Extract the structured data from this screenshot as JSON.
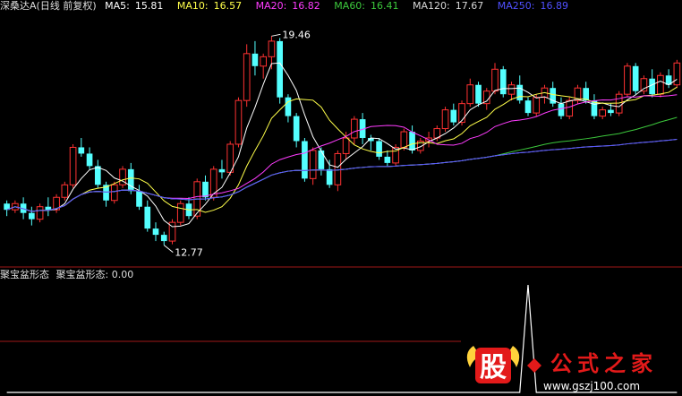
{
  "header": {
    "stock": "深桑达A",
    "mode": "(日线 前复权)",
    "indicators": [
      {
        "label": "MA5:",
        "value": "15.81",
        "color": "#ffffff"
      },
      {
        "label": "MA10:",
        "value": "16.57",
        "color": "#ffff4a"
      },
      {
        "label": "MA20:",
        "value": "16.82",
        "color": "#ff3cff"
      },
      {
        "label": "MA60:",
        "value": "16.41",
        "color": "#3cc83c"
      },
      {
        "label": "MA120:",
        "value": "17.67",
        "color": "#d7d7d7"
      },
      {
        "label": "MA250:",
        "value": "16.89",
        "color": "#5050ff"
      }
    ]
  },
  "sub_panel": {
    "title": "聚宝盆形态",
    "indicator": "聚宝盆形态:",
    "value": "0.00"
  },
  "watermark": {
    "char": "股",
    "brand": "公式之家",
    "url": "www.gszj100.com"
  },
  "colors": {
    "up": "#ff3232",
    "down": "#54ffff",
    "ma5": "#ffffff",
    "ma10": "#ffff4a",
    "ma20": "#ff3cff",
    "ma60": "#3cc83c",
    "ma120": "#d7d7d7",
    "ma250": "#5050ff",
    "separator": "#a01818"
  },
  "chart_data": [
    {
      "type": "candlestick",
      "annotations": [
        {
          "label": "19.46",
          "value": 19.46
        },
        {
          "label": "12.77",
          "value": 12.77
        }
      ],
      "ylim": [
        12.3,
        20.1
      ],
      "candles": [
        [
          14.1,
          14.2,
          13.7,
          13.9
        ],
        [
          13.9,
          14.2,
          13.8,
          14.1
        ],
        [
          14.1,
          14.3,
          13.6,
          13.8
        ],
        [
          13.8,
          14.0,
          13.4,
          13.6
        ],
        [
          13.6,
          14.1,
          13.5,
          14.0
        ],
        [
          14.0,
          14.3,
          13.7,
          13.9
        ],
        [
          13.9,
          14.4,
          13.8,
          14.3
        ],
        [
          14.3,
          14.8,
          14.2,
          14.7
        ],
        [
          14.7,
          16.0,
          14.6,
          15.9
        ],
        [
          15.9,
          16.2,
          15.6,
          15.7
        ],
        [
          15.7,
          15.9,
          15.2,
          15.3
        ],
        [
          15.3,
          15.5,
          14.6,
          14.7
        ],
        [
          14.7,
          14.8,
          14.0,
          14.2
        ],
        [
          14.2,
          14.8,
          14.1,
          14.7
        ],
        [
          14.7,
          15.3,
          14.6,
          15.2
        ],
        [
          15.2,
          15.4,
          14.4,
          14.5
        ],
        [
          14.5,
          14.7,
          13.9,
          14.0
        ],
        [
          14.0,
          14.2,
          13.2,
          13.3
        ],
        [
          13.3,
          13.5,
          12.9,
          13.1
        ],
        [
          13.1,
          13.2,
          12.77,
          12.9
        ],
        [
          12.9,
          13.6,
          12.8,
          13.5
        ],
        [
          13.5,
          14.2,
          13.4,
          14.1
        ],
        [
          14.1,
          14.3,
          13.6,
          13.7
        ],
        [
          13.7,
          14.9,
          13.6,
          14.8
        ],
        [
          14.8,
          15.0,
          14.2,
          14.3
        ],
        [
          14.3,
          15.3,
          14.2,
          15.2
        ],
        [
          15.2,
          15.5,
          14.9,
          15.1
        ],
        [
          15.1,
          16.1,
          15.0,
          16.0
        ],
        [
          16.0,
          17.5,
          15.9,
          17.4
        ],
        [
          17.4,
          19.2,
          17.2,
          18.9
        ],
        [
          18.9,
          19.3,
          18.2,
          18.5
        ],
        [
          18.5,
          18.9,
          18.1,
          18.8
        ],
        [
          18.8,
          19.46,
          18.4,
          19.3
        ],
        [
          19.3,
          19.4,
          17.3,
          17.5
        ],
        [
          17.5,
          17.6,
          16.7,
          16.9
        ],
        [
          16.9,
          17.0,
          15.9,
          16.1
        ],
        [
          16.1,
          16.2,
          14.8,
          14.9
        ],
        [
          14.9,
          15.9,
          14.7,
          15.8
        ],
        [
          15.8,
          15.9,
          15.0,
          15.2
        ],
        [
          15.2,
          15.5,
          14.6,
          14.7
        ],
        [
          14.7,
          15.8,
          14.5,
          15.7
        ],
        [
          15.7,
          16.4,
          15.5,
          16.2
        ],
        [
          16.2,
          16.9,
          16.0,
          16.8
        ],
        [
          16.8,
          17.0,
          16.0,
          16.2
        ],
        [
          16.2,
          16.3,
          15.8,
          16.1
        ],
        [
          16.1,
          16.2,
          15.5,
          15.6
        ],
        [
          15.6,
          15.8,
          15.3,
          15.4
        ],
        [
          15.4,
          16.0,
          15.3,
          15.9
        ],
        [
          15.9,
          16.5,
          15.8,
          16.4
        ],
        [
          16.4,
          16.6,
          15.7,
          15.8
        ],
        [
          15.8,
          16.2,
          15.7,
          16.1
        ],
        [
          16.1,
          16.4,
          15.9,
          16.2
        ],
        [
          16.2,
          16.6,
          16.1,
          16.5
        ],
        [
          16.5,
          17.2,
          16.4,
          17.1
        ],
        [
          17.1,
          17.3,
          16.6,
          16.7
        ],
        [
          16.7,
          17.4,
          16.6,
          17.3
        ],
        [
          17.3,
          18.1,
          17.2,
          17.9
        ],
        [
          17.9,
          18.0,
          17.2,
          17.3
        ],
        [
          17.3,
          17.8,
          17.1,
          17.7
        ],
        [
          17.7,
          18.6,
          17.6,
          18.4
        ],
        [
          18.4,
          18.5,
          17.5,
          17.6
        ],
        [
          17.6,
          18.0,
          17.4,
          17.9
        ],
        [
          17.9,
          18.2,
          17.3,
          17.4
        ],
        [
          17.4,
          17.5,
          16.9,
          17.0
        ],
        [
          17.0,
          17.6,
          16.9,
          17.5
        ],
        [
          17.5,
          17.9,
          17.3,
          17.8
        ],
        [
          17.8,
          18.0,
          17.2,
          17.3
        ],
        [
          17.3,
          17.5,
          16.8,
          16.9
        ],
        [
          16.9,
          17.5,
          16.8,
          17.4
        ],
        [
          17.4,
          17.9,
          17.3,
          17.8
        ],
        [
          17.8,
          18.0,
          17.3,
          17.4
        ],
        [
          17.4,
          17.6,
          16.8,
          16.9
        ],
        [
          16.9,
          17.2,
          16.8,
          17.1
        ],
        [
          17.1,
          17.3,
          16.9,
          17.0
        ],
        [
          17.0,
          17.7,
          16.9,
          17.6
        ],
        [
          17.6,
          18.6,
          17.5,
          18.5
        ],
        [
          18.5,
          18.6,
          17.6,
          17.7
        ],
        [
          17.7,
          18.2,
          17.6,
          18.1
        ],
        [
          18.1,
          18.4,
          17.5,
          17.6
        ],
        [
          17.6,
          18.3,
          17.5,
          18.2
        ],
        [
          18.2,
          18.4,
          17.8,
          17.9
        ],
        [
          17.9,
          18.7,
          17.8,
          18.6
        ]
      ]
    },
    {
      "type": "line",
      "title": "聚宝盆形态",
      "ylim": [
        0,
        1
      ],
      "values": [
        0,
        0,
        0,
        0,
        0,
        0,
        0,
        0,
        0,
        0,
        0,
        0,
        0,
        0,
        0,
        0,
        0,
        0,
        0,
        0,
        0,
        0,
        0,
        0,
        0,
        0,
        0,
        0,
        0,
        0,
        0,
        0,
        0,
        0,
        0,
        0,
        0,
        0,
        0,
        0,
        0,
        0,
        0,
        0,
        0,
        0,
        0,
        0,
        0,
        0,
        0,
        0,
        0,
        0,
        0,
        0,
        0,
        0,
        0,
        0,
        0,
        0,
        0,
        1,
        0,
        0,
        0,
        0,
        0,
        0,
        0,
        0,
        0,
        0,
        0,
        0,
        0,
        0,
        0,
        0,
        0,
        0
      ]
    }
  ]
}
